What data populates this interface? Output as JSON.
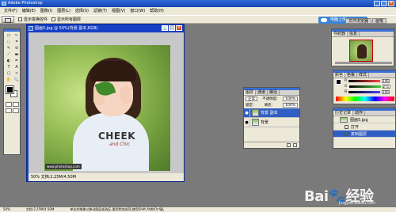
{
  "titlebar": {
    "title": "Adobe Photoshop",
    "min": "_",
    "max": "□",
    "close": "×"
  },
  "menubar": [
    "文件(F)",
    "编辑(E)",
    "图像(I)",
    "图层(L)",
    "选择(S)",
    "滤镜(T)",
    "视图(V)",
    "窗口(W)",
    "帮助(H)"
  ],
  "options": {
    "check1": "显示变换控件",
    "check2": "显示所有图层",
    "upload": "电脑上传"
  },
  "well_tabs": [
    "文件浏览器",
    "画笔"
  ],
  "toolbox": {
    "tools": [
      "▭",
      "↖",
      "◌",
      "⌗",
      "✎",
      "⊘",
      "⟋",
      "▬",
      "◐",
      "✒",
      "T",
      "A",
      "▢",
      "⌑",
      "✋",
      "🔍"
    ]
  },
  "document": {
    "title": "图画5.jpg @ 50%(背景 副本,RGB)",
    "min": "_",
    "max": "□",
    "close": "×",
    "status": "50%   文档:2.25M/4.50M",
    "shirt_text": "CHEEK",
    "shirt_sub": "and Chic",
    "watermark": "www.photoshop.com"
  },
  "layers_panel": {
    "tabs": [
      "图层",
      "通道",
      "路径"
    ],
    "blend_mode": "正常",
    "opacity_label": "不透明度:",
    "opacity": "100%",
    "fill_label": "填充:",
    "fill": "100%",
    "lock_label": "锁定:",
    "rows": [
      {
        "name": "背景 副本",
        "selected": true
      },
      {
        "name": "背景",
        "selected": false
      }
    ]
  },
  "navigator": {
    "tabs": [
      "导航器",
      "信息"
    ]
  },
  "color_panel": {
    "tabs": [
      "颜色",
      "色板",
      "样式"
    ],
    "rows": [
      {
        "label": "R",
        "value": "146",
        "color": "#d44"
      },
      {
        "label": "G",
        "value": "271",
        "color": "#4a4"
      },
      {
        "label": "B",
        "value": "100",
        "color": "#44d"
      }
    ]
  },
  "history": {
    "tabs": [
      "历史记录",
      "动作"
    ],
    "rows": [
      {
        "name": "图画5.jpg",
        "kind": "thumb",
        "selected": false
      },
      {
        "name": "打开",
        "kind": "icon",
        "selected": false
      },
      {
        "name": "复制图层",
        "kind": "icon",
        "selected": true
      }
    ]
  },
  "statusbar": [
    "50%",
    "文档:2.25M/4.50M",
    "单击并拖移以移动图层或选区,要用附加选项,使用Shift,Alt和Ctrl键。"
  ],
  "baidu": {
    "logo": "Bai🐾经验",
    "url": "jingyan.baidu.com"
  }
}
